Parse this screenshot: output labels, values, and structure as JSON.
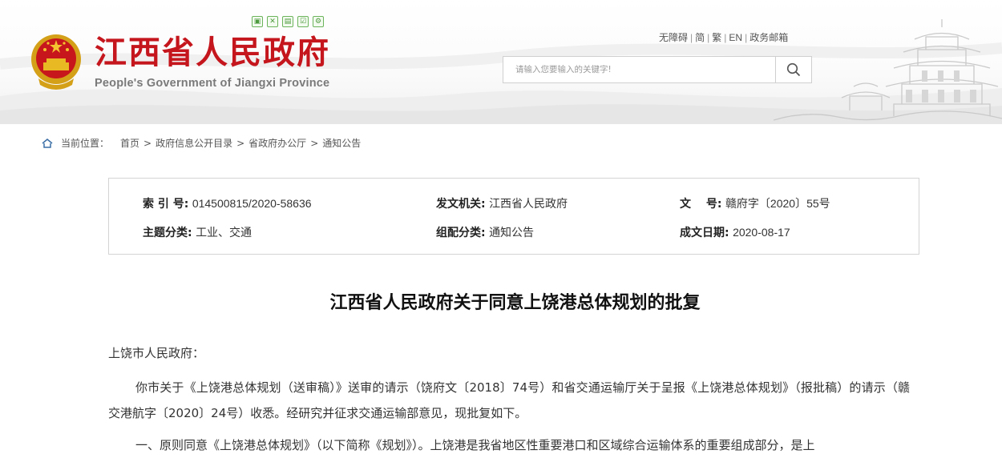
{
  "header": {
    "site_title": "江西省人民政府",
    "site_subtitle": "People's Government of Jiangxi Province",
    "tool_icons": [
      "print-icon",
      "share-icon",
      "bookmark-icon",
      "edit-icon",
      "settings-icon"
    ],
    "top_links": [
      "无障碍",
      "简",
      "繁",
      "EN",
      "政务邮箱"
    ],
    "search_placeholder": "请输入您要输入的关键字!",
    "accent_color": "#c4161c"
  },
  "breadcrumb": {
    "label": "当前位置：",
    "items": [
      "首页",
      "政府信息公开目录",
      "省政府办公厅",
      "通知公告"
    ],
    "separator": ">"
  },
  "meta": {
    "index_label": "索 引 号:",
    "index_value": "014500815/2020-58636",
    "issuer_label": "发文机关:",
    "issuer_value": "江西省人民政府",
    "doc_no_label": "文　 号:",
    "doc_no_value": "赣府字〔2020〕55号",
    "topic_label": "主题分类:",
    "topic_value": "工业、交通",
    "category_label": "组配分类:",
    "category_value": "通知公告",
    "date_label": "成文日期:",
    "date_value": "2020-08-17"
  },
  "article": {
    "title": "江西省人民政府关于同意上饶港总体规划的批复",
    "salutation": "上饶市人民政府：",
    "paragraphs": [
      "你市关于《上饶港总体规划（送审稿）》送审的请示（饶府文〔2018〕74号）和省交通运输厅关于呈报《上饶港总体规划》（报批稿）的请示（赣交港航字〔2020〕24号）收悉。经研究并征求交通运输部意见，现批复如下。",
      "一、原则同意《上饶港总体规划》（以下简称《规划》）。上饶港是我省地区性重要港口和区域综合运输体系的重要组成部分，是上"
    ]
  }
}
